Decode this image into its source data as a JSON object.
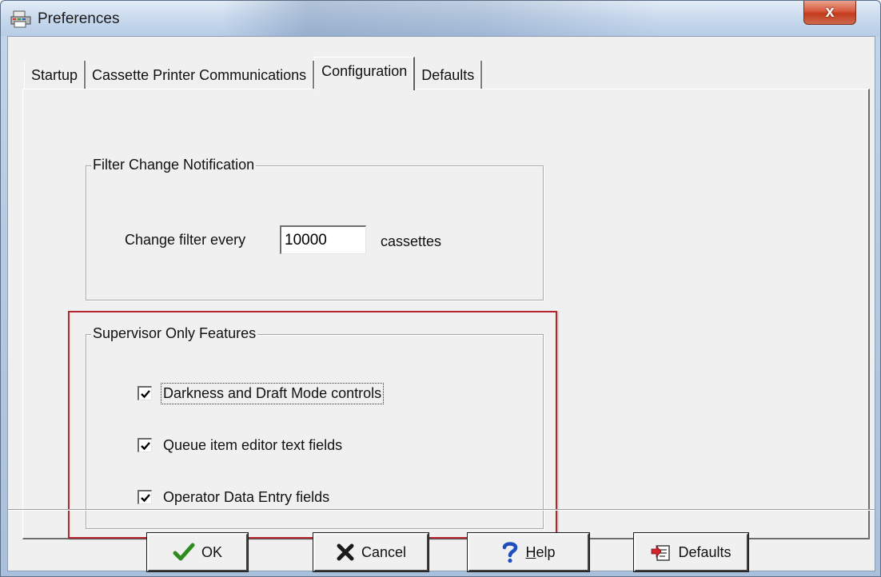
{
  "window": {
    "title": "Preferences",
    "close_glyph": "x"
  },
  "tabs": [
    {
      "label": "Startup",
      "active": false
    },
    {
      "label": "Cassette Printer Communications",
      "active": false
    },
    {
      "label": "Configuration",
      "active": true
    },
    {
      "label": "Defaults",
      "active": false
    }
  ],
  "filter_group": {
    "title": "Filter Change Notification",
    "prefix_label": "Change filter every",
    "value": "10000",
    "suffix_label": "cassettes"
  },
  "supervisor_group": {
    "title": "Supervisor Only Features",
    "options": [
      {
        "label": "Darkness and Draft Mode controls",
        "checked": true
      },
      {
        "label": "Queue item editor text fields",
        "checked": true
      },
      {
        "label": "Operator Data Entry fields",
        "checked": true
      }
    ]
  },
  "buttons": {
    "ok": "OK",
    "cancel": "Cancel",
    "help": "Help",
    "defaults": "Defaults"
  },
  "colors": {
    "highlight": "#b4262e",
    "ok_check": "#2e8b1e",
    "cancel_x": "#1a1a1a",
    "help_q": "#1f4fbf"
  },
  "icons": {
    "app": "printer-icon",
    "ok": "checkmark-icon",
    "cancel": "x-mark-icon",
    "help": "question-mark-icon",
    "defaults": "defaults-document-icon"
  }
}
